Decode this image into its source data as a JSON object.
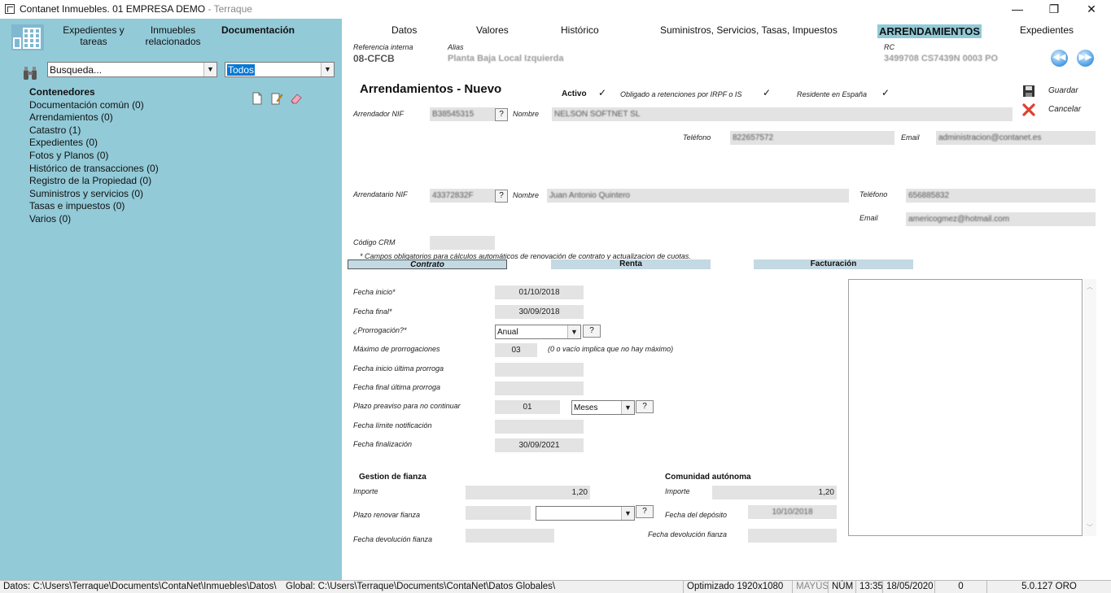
{
  "window": {
    "title": "Contanet Inmuebles. 01 EMPRESA DEMO",
    "title_suffix": "- Terraque",
    "minimize": "—",
    "maximize": "❐",
    "close": "✕"
  },
  "sidebar": {
    "nav": [
      {
        "label": "Expedientes y tareas"
      },
      {
        "label": "Inmuebles relacionados"
      },
      {
        "label": "Documentación"
      }
    ],
    "search_value": "Busqueda...",
    "filter_value": "Todos",
    "tree_header": "Contenedores",
    "tree_items": [
      "Documentación común (0)",
      "Arrendamientos (0)",
      "Catastro (1)",
      "Expedientes (0)",
      "Fotos y Planos (0)",
      "Histórico de transacciones (0)",
      "Registro de la Propiedad (0)",
      "Suministros y servicios (0)",
      "Tasas e impuestos (0)",
      "Varios (0)"
    ]
  },
  "tabs": [
    "Datos",
    "Valores",
    "Histórico",
    "Suministros, Servicios, Tasas, Impuestos",
    "ARRENDAMIENTOS",
    "Expedientes"
  ],
  "header": {
    "ref_label": "Referencia interna",
    "ref_value": "08-CFCB",
    "alias_label": "Alias",
    "alias_value": "Planta Baja Local Izquierda",
    "rc_label": "RC",
    "rc_value": "3499708 CS7439N 0003 PO"
  },
  "form": {
    "title": "Arrendamientos -  Nuevo",
    "activo_label": "Activo",
    "irpf_label": "Obligado a retenciones por IRPF o IS",
    "residente_label": "Residente en España",
    "check": "✓",
    "guardar": "Guardar",
    "cancelar": "Cancelar",
    "arrendador_nif_label": "Arrendador NIF",
    "arrendador_nif": "B38545315",
    "nombre_label": "Nombre",
    "arrendador_nombre": "NELSON SOFTNET SL",
    "telefono_label": "Teléfono",
    "arrendador_telefono": "822657572",
    "email_label": "Email",
    "arrendador_email": "administracion@contanet.es",
    "arrendatario_nif_label": "Arrendatario NIF",
    "arrendatario_nif": "43372832F",
    "arrendatario_nombre": "Juan Antonio Quintero",
    "arrendatario_telefono": "656885832",
    "arrendatario_email": "americogmez@hotmail.com",
    "codigo_crm_label": "Código CRM",
    "note": "* Campos obligatorios para cálculos automáticos de renovación de contrato y actualizacion de cuotas.",
    "q": "?"
  },
  "sections": [
    "Contrato",
    "Renta",
    "Facturación"
  ],
  "contrato": {
    "fecha_inicio_label": "Fecha inicio*",
    "fecha_inicio": "01/10/2018",
    "fecha_final_label": "Fecha final*",
    "fecha_final": "30/09/2018",
    "prorrogacion_label": "¿Prorrogación?*",
    "prorrogacion": "Anual",
    "max_prorrogaciones_label": "Máximo de prorrogaciones",
    "max_prorrogaciones": "03",
    "max_note": "(0 o vacío implica que no hay máximo)",
    "fecha_inicio_ultima_label": "Fecha inicio última prorroga",
    "fecha_final_ultima_label": "Fecha final última prorroga",
    "plazo_preaviso_label": "Plazo preaviso para no continuar",
    "plazo_preaviso": "01",
    "plazo_unidad": "Meses",
    "fecha_limite_label": "Fecha límite notificación",
    "fecha_finalizacion_label": "Fecha finalización",
    "fecha_finalizacion": "30/09/2021"
  },
  "fianza": {
    "title": "Gestion de fianza",
    "importe_label": "Importe",
    "importe": "1,20",
    "plazo_renovar_label": "Plazo renovar fianza",
    "fecha_devolucion_label": "Fecha devolución fianza"
  },
  "comunidad": {
    "title": "Comunidad autónoma",
    "importe_label": "Importe",
    "importe": "1,20",
    "fecha_deposito_label": "Fecha del depósito",
    "fecha_deposito": "10/10/2018",
    "fecha_devolucion_label": "Fecha devolución fianza"
  },
  "status": {
    "datos": "Datos: C:\\Users\\Terraque\\Documents\\ContaNet\\Inmuebles\\Datos\\",
    "global": "Global: C:\\Users\\Terraque\\Documents\\ContaNet\\Datos Globales\\",
    "optimizado": "Optimizado 1920x1080",
    "mayus": "MAYÚS",
    "num": "NÚM",
    "time": "13:35",
    "date": "18/05/2020",
    "count": "0",
    "version": "5.0.127 ORO"
  }
}
